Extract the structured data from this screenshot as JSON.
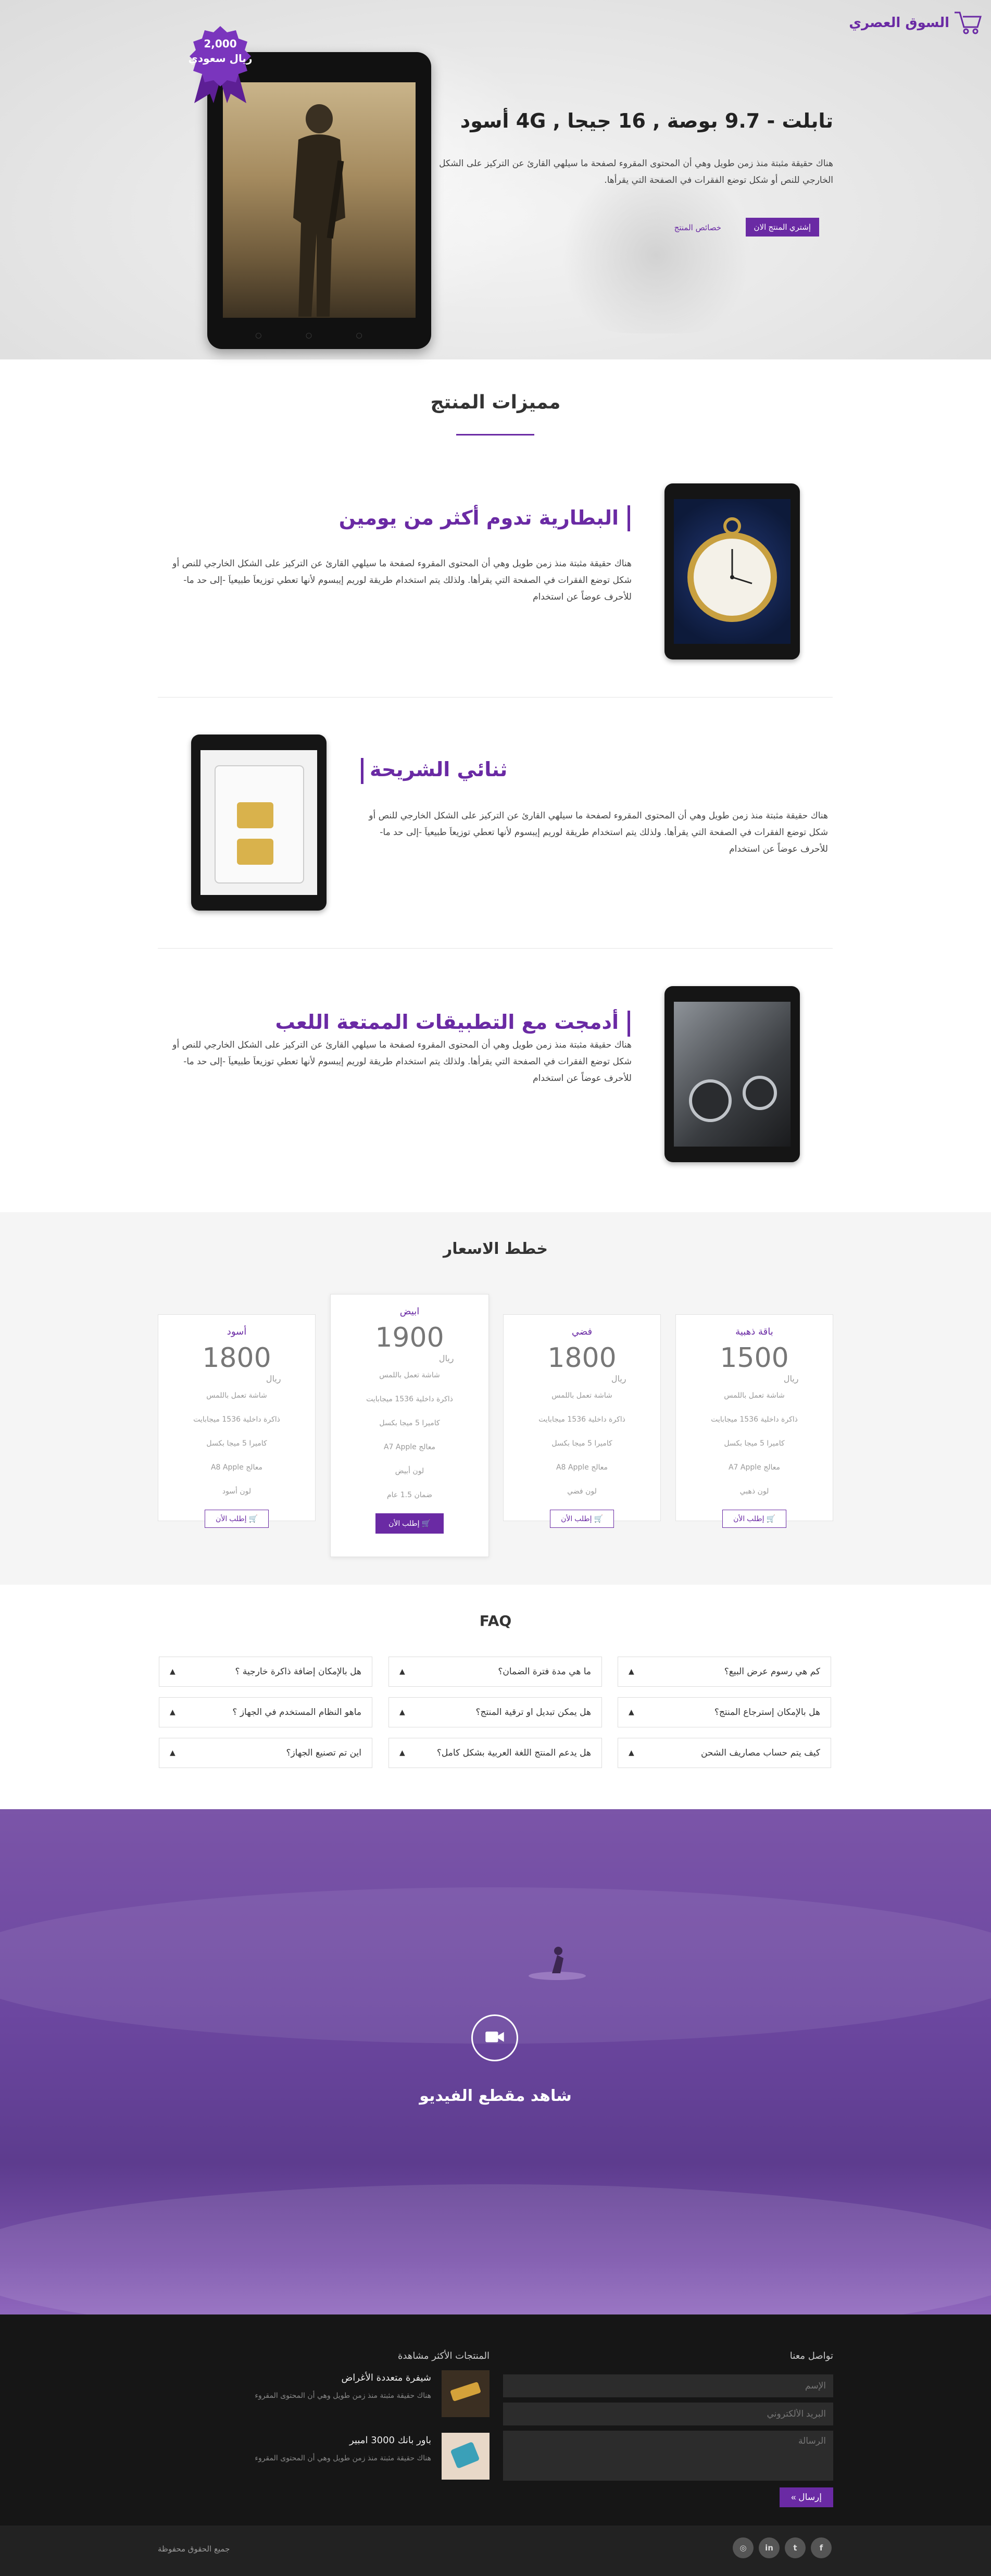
{
  "brand": {
    "name": "السوق العصري",
    "accent": "#6a2aa4"
  },
  "hero": {
    "badge_price": "2,000",
    "badge_currency": "ريال سعودي",
    "title": "تابلت - 9.7 بوصة , 16 جيجا , 4G أسود",
    "description": "هناك حقيقة مثبتة منذ زمن طويل وهي أن المحتوى المقروء لصفحة ما سيلهي القارئ عن التركيز على الشكل الخارجي للنص أو شكل توضع الفقرات في الصفحة التي يقرأها.",
    "buy_label": "إشتري المنتج الان",
    "features_link": "خصائص المنتج"
  },
  "features": {
    "title": "مميزات المنتج",
    "items": [
      {
        "title": "البطارية تدوم أكثر من يومين",
        "text": "هناك حقيقة مثبتة منذ زمن طويل وهي أن المحتوى المقروء لصفحة ما سيلهي القارئ عن التركيز على الشكل الخارجي للنص أو شكل توضع الفقرات في الصفحة التي يقرأها. ولذلك يتم استخدام طريقة لوريم إيبسوم لأنها تعطي توزيعاَ طبيعياَ -إلى حد ما- للأحرف عوضاً عن استخدام"
      },
      {
        "title": "ثنائي الشريحة",
        "text": "هناك حقيقة مثبتة منذ زمن طويل وهي أن المحتوى المقروء لصفحة ما سيلهي القارئ عن التركيز على الشكل الخارجي للنص أو شكل توضع الفقرات في الصفحة التي يقرأها. ولذلك يتم استخدام طريقة لوريم إيبسوم لأنها تعطي توزيعاَ طبيعياَ -إلى حد ما- للأحرف عوضاً عن استخدام"
      },
      {
        "title": "أدمجت مع التطبيقات الممتعة اللعب",
        "text": "هناك حقيقة مثبتة منذ زمن طويل وهي أن المحتوى المقروء لصفحة ما سيلهي القارئ عن التركيز على الشكل الخارجي للنص أو شكل توضع الفقرات في الصفحة التي يقرأها. ولذلك يتم استخدام طريقة لوريم إيبسوم لأنها تعطي توزيعاَ طبيعياَ -إلى حد ما- للأحرف عوضاً عن استخدام"
      }
    ]
  },
  "pricing": {
    "title": "خطط الاسعار",
    "currency": "ريال",
    "order_label": "إطلب الأن",
    "plans": [
      {
        "name": "باقة ذهبية",
        "price": "1500",
        "features": [
          "شاشة تعمل باللمس",
          "ذاكرة داخلية 1536 ميجابايت",
          "كاميرا 5 ميجا بكسل",
          "معالج A7 Apple",
          "لون ذهبي"
        ]
      },
      {
        "name": "فضي",
        "price": "1800",
        "features": [
          "شاشة تعمل باللمس",
          "ذاكرة داخلية 1536 ميجابايت",
          "كاميرا 5 ميجا بكسل",
          "معالج A8 Apple",
          "لون فضي"
        ]
      },
      {
        "name": "ابيض",
        "price": "1900",
        "features": [
          "شاشة تعمل باللمس",
          "ذاكرة داخلية 1536 ميجابايت",
          "كاميرا 5 ميجا بكسل",
          "معالج A7 Apple",
          "لون أبيض",
          "ضمان 1.5 عام"
        ]
      },
      {
        "name": "أسود",
        "price": "1800",
        "features": [
          "شاشة تعمل باللمس",
          "ذاكرة داخلية 1536 ميجابايت",
          "كاميرا 5 ميجا بكسل",
          "معالج A8 Apple",
          "لون أسود"
        ]
      }
    ]
  },
  "faq": {
    "title": "FAQ",
    "items": [
      "كم هي رسوم عرض البيع؟",
      "ما هي مدة فترة الضمان؟",
      "هل بالإمكان إضافة ذاكرة خارجية ؟",
      "هل بالإمكان إسترجاع المنتج؟",
      "هل يمكن تبديل او ترقية المنتج؟",
      "ماهو النظام المستخدم في الجهاز ؟",
      "كيف يتم حساب مصاريف الشحن",
      "هل يدعم المنتج اللغة العربية بشكل كامل؟",
      "اين تم تصنيع الجهاز؟"
    ]
  },
  "video": {
    "title": "شاهد مقطع الفيديو"
  },
  "footer": {
    "contact_title": "تواصل معنا",
    "name_placeholder": "الإسم",
    "email_placeholder": "البريد الألكتروني",
    "message_placeholder": "الرسالة",
    "send_label": "إرسال",
    "popular_title": "المنتجات الأكثر مشاهدة",
    "popular": [
      {
        "title": "شيفرة متعددة الأغراض",
        "text": "هناك حقيقة مثبتة منذ زمن طويل وهي أن المحتوى المقروء"
      },
      {
        "title": "باور بانك 3000 امبير",
        "text": "هناك حقيقة مثبتة منذ زمن طويل وهي أن المحتوى المقروء"
      }
    ],
    "copyright": "جميع الحقوق محفوظة",
    "social": [
      "facebook-icon",
      "twitter-icon",
      "linkedin-icon",
      "instagram-icon"
    ]
  }
}
